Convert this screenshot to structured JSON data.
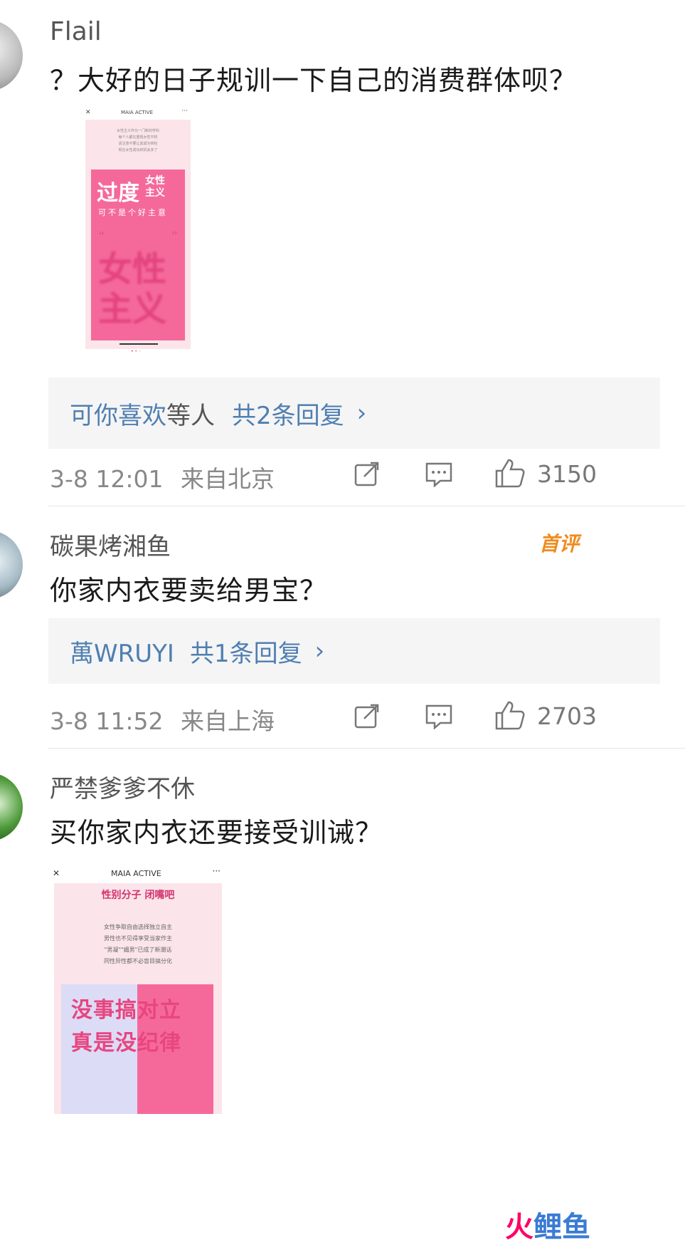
{
  "comments": [
    {
      "user": "Flail",
      "text": "？大好的日子规训一下自己的消费群体呗？",
      "image": {
        "topbar_title": "MAIA ACTIVE",
        "intro_lines": [
          "女性主义作为一门新的学科",
          "每个人都在重视女性平权",
          "请注意不要让其成为矫枉",
          "现在女性成功的机会多了"
        ],
        "big_word": "过度",
        "small_words": [
          "女性",
          "主义"
        ],
        "tagline": "可不是个好主意",
        "bottom_words": [
          "女性",
          "主义"
        ]
      },
      "reply": {
        "names": "可你喜欢",
        "mid": "等人",
        "count": "共2条回复"
      },
      "time": "3-8 12:01",
      "location": "来自北京",
      "likes": "3150"
    },
    {
      "user": "碳果烤湘鱼",
      "badge": "首评",
      "text": "你家内衣要卖给男宝？",
      "reply": {
        "names": "萬WRUYI",
        "mid": "",
        "count": "共1条回复"
      },
      "time": "3-8 11:52",
      "location": "来自上海",
      "likes": "2703"
    },
    {
      "user": "严禁爹爹不休",
      "text": "买你家内衣还要接受训诫？",
      "image": {
        "topbar_title": "MAIA ACTIVE",
        "heading": "性别分子 闭嘴吧",
        "intro_lines": [
          "女性争取自由选择独立自主",
          "男性也不见得享受当家作主",
          "\"男凝\"\"媚男\"已成了新潮话",
          "同性异性都不必盲目搞分化"
        ],
        "slogan_lines": [
          "没事搞对立",
          "真是没纪律"
        ]
      }
    }
  ],
  "watermark": "火鲤鱼",
  "colors": {
    "link": "#4f7fb1",
    "pink": "#f5699a",
    "badge": "#f08b1e"
  }
}
